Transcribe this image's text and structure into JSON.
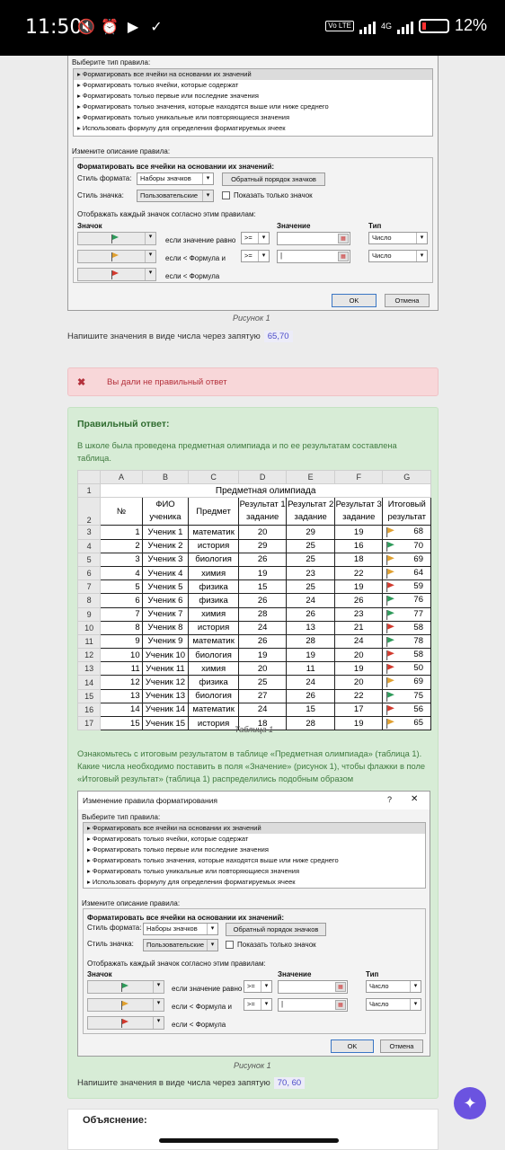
{
  "status": {
    "time": "11:50",
    "battery": "12%",
    "network": "4G",
    "volte": "Vo LTE"
  },
  "dialog_top": {
    "select_rule_type": "Выберите тип правила:",
    "rule_types": [
      "▸ Форматировать все ячейки на основании их значений",
      "▸ Форматировать только ячейки, которые содержат",
      "▸ Форматировать только первые или последние значения",
      "▸ Форматировать только значения, которые находятся выше или ниже среднего",
      "▸ Форматировать только уникальные или повторяющиеся значения",
      "▸ Использовать формулу для определения форматируемых ячеек"
    ],
    "edit_desc": "Измените описание правила:",
    "format_all": "Форматировать все ячейки на основании их значений:",
    "format_style_label": "Стиль формата:",
    "format_style_value": "Наборы значков",
    "reverse_button": "Обратный порядок значков",
    "icon_style_label": "Стиль значка:",
    "icon_style_value": "Пользовательские",
    "show_icon_only": "Показать только значок",
    "display_rule": "Отображать каждый значок согласно этим правилам:",
    "col_icon": "Значок",
    "col_value": "Значение",
    "col_type": "Тип",
    "rows": [
      {
        "cond": "если значение равно",
        "op": ">=",
        "value": "",
        "type": "Число"
      },
      {
        "cond": "если < Формула и",
        "op": ">=",
        "value": "|",
        "type": "Число"
      },
      {
        "cond": "если < Формула",
        "op": "",
        "value": "",
        "type": ""
      }
    ],
    "ok": "OK",
    "cancel": "Отмена"
  },
  "caption1": "Рисунок 1",
  "question_text": "Напишите значения в виде числа через запятую",
  "user_answer": "65,70",
  "error_text": "Вы дали не правильный ответ",
  "error_icon": "✖",
  "correct": {
    "title": "Правильный ответ:",
    "intro": "В школе была проведена предметная олимпиада и по ее результатам составлена таблица.",
    "table_caption": "Таблица 1",
    "task": "Ознакомьтесь с итоговым результатом в таблице «Предметная олимпиада» (таблица 1). Какие числа необходимо поставить в поля «Значение» (рисунок 1), чтобы флажки в поле «Итоговый результат» (таблица 1) распределились подобным образом",
    "caption2": "Рисунок 1",
    "question_text": "Напишите значения в виде числа через запятую",
    "answer": "70, 60"
  },
  "sheet": {
    "col_headers": [
      "",
      "A",
      "B",
      "C",
      "D",
      "E",
      "F",
      "G"
    ],
    "title": "Предметная олимпиада",
    "headers": [
      "№",
      "ФИО ученика",
      "Предмет",
      "Результат 1 задание",
      "Результат 2 задание",
      "Результат 3 задание",
      "Итоговый результат"
    ],
    "rows": [
      [
        "1",
        "Ученик 1",
        "математик",
        "20",
        "29",
        "19",
        "68"
      ],
      [
        "2",
        "Ученик 2",
        "история",
        "29",
        "25",
        "16",
        "70"
      ],
      [
        "3",
        "Ученик 3",
        "биология",
        "26",
        "25",
        "18",
        "69"
      ],
      [
        "4",
        "Ученик 4",
        "химия",
        "19",
        "23",
        "22",
        "64"
      ],
      [
        "5",
        "Ученик 5",
        "физика",
        "15",
        "25",
        "19",
        "59"
      ],
      [
        "6",
        "Ученик 6",
        "физика",
        "26",
        "24",
        "26",
        "76"
      ],
      [
        "7",
        "Ученик 7",
        "химия",
        "28",
        "26",
        "23",
        "77"
      ],
      [
        "8",
        "Ученик 8",
        "история",
        "24",
        "13",
        "21",
        "58"
      ],
      [
        "9",
        "Ученик 9",
        "математик",
        "26",
        "28",
        "24",
        "78"
      ],
      [
        "10",
        "Ученик 10",
        "биология",
        "19",
        "19",
        "20",
        "58"
      ],
      [
        "11",
        "Ученик 11",
        "химия",
        "20",
        "11",
        "19",
        "50"
      ],
      [
        "12",
        "Ученик 12",
        "физика",
        "25",
        "24",
        "20",
        "69"
      ],
      [
        "13",
        "Ученик 13",
        "биология",
        "27",
        "26",
        "22",
        "75"
      ],
      [
        "14",
        "Ученик 14",
        "математик",
        "24",
        "15",
        "17",
        "56"
      ],
      [
        "15",
        "Ученик 15",
        "история",
        "18",
        "28",
        "19",
        "65"
      ]
    ]
  },
  "dialog_bottom": {
    "window_title": "Изменение правила форматирования",
    "help": "?",
    "close": "✕"
  },
  "explanation_title": "Объяснение:",
  "flag_colors": {
    "green": "#2e9a5a",
    "yellow": "#e0a030",
    "red": "#d23a2e"
  }
}
